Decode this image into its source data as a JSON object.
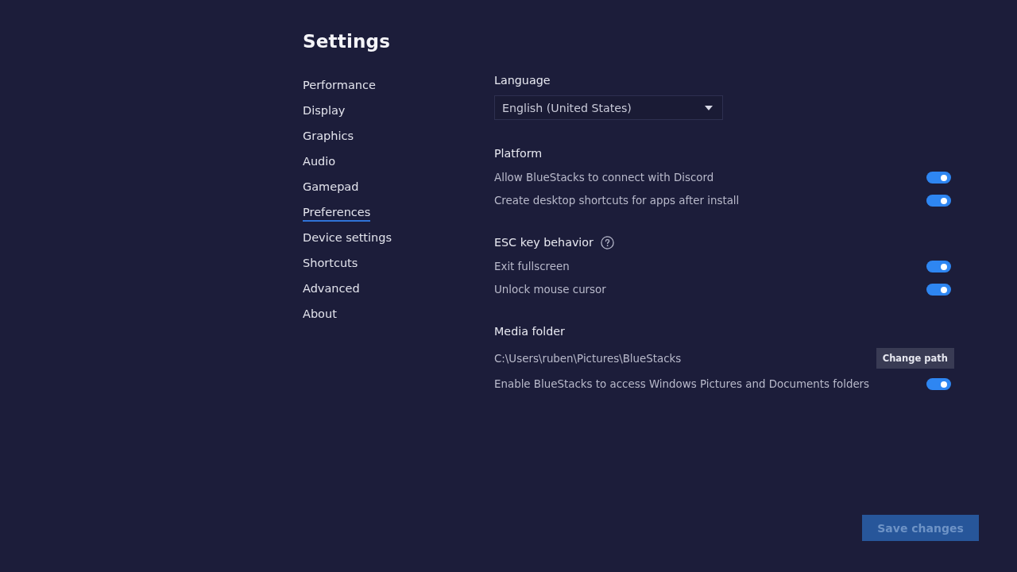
{
  "title": "Settings",
  "sidebar": {
    "items": [
      {
        "label": "Performance",
        "selected": false
      },
      {
        "label": "Display",
        "selected": false
      },
      {
        "label": "Graphics",
        "selected": false
      },
      {
        "label": "Audio",
        "selected": false
      },
      {
        "label": "Gamepad",
        "selected": false
      },
      {
        "label": "Preferences",
        "selected": true
      },
      {
        "label": "Device settings",
        "selected": false
      },
      {
        "label": "Shortcuts",
        "selected": false
      },
      {
        "label": "Advanced",
        "selected": false
      },
      {
        "label": "About",
        "selected": false
      }
    ]
  },
  "language": {
    "label": "Language",
    "value": "English (United States)"
  },
  "sections": [
    {
      "title": "Platform",
      "help": false,
      "rows": [
        {
          "kind": "toggle",
          "label": "Allow BlueStacks to connect with Discord",
          "on": true
        },
        {
          "kind": "toggle",
          "label": "Create desktop shortcuts for apps after install",
          "on": true
        }
      ]
    },
    {
      "title": "ESC key behavior",
      "help": true,
      "rows": [
        {
          "kind": "toggle",
          "label": "Exit fullscreen",
          "on": true
        },
        {
          "kind": "toggle",
          "label": "Unlock mouse cursor",
          "on": true
        }
      ]
    },
    {
      "title": "Media folder",
      "help": false,
      "rows": [
        {
          "kind": "path",
          "label": "C:\\Users\\ruben\\Pictures\\BlueStacks",
          "button": "Change path"
        },
        {
          "kind": "toggle",
          "label": "Enable BlueStacks to access Windows Pictures and Documents folders",
          "on": true
        }
      ]
    }
  ],
  "save_button": {
    "label": "Save changes",
    "disabled": true
  }
}
